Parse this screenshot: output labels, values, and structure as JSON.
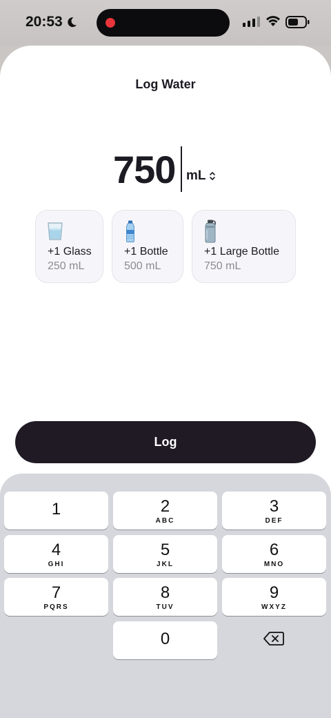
{
  "status_bar": {
    "time": "20:53"
  },
  "sheet": {
    "title": "Log Water"
  },
  "amount": {
    "value": "750",
    "unit": "mL"
  },
  "presets": [
    {
      "icon": "glass-icon",
      "label": "+1 Glass",
      "volume": "250 mL"
    },
    {
      "icon": "bottle-icon",
      "label": "+1 Bottle",
      "volume": "500 mL"
    },
    {
      "icon": "large-bottle-icon",
      "label": "+1 Large Bottle",
      "volume": "750 mL"
    }
  ],
  "log_button": {
    "label": "Log"
  },
  "keypad": {
    "keys": [
      {
        "digit": "1",
        "letters": ""
      },
      {
        "digit": "2",
        "letters": "ABC"
      },
      {
        "digit": "3",
        "letters": "DEF"
      },
      {
        "digit": "4",
        "letters": "GHI"
      },
      {
        "digit": "5",
        "letters": "JKL"
      },
      {
        "digit": "6",
        "letters": "MNO"
      },
      {
        "digit": "7",
        "letters": "PQRS"
      },
      {
        "digit": "8",
        "letters": "TUV"
      },
      {
        "digit": "9",
        "letters": "WXYZ"
      },
      {
        "digit": "0",
        "letters": ""
      }
    ],
    "delete_icon": "delete-backspace-icon"
  },
  "colors": {
    "primary_dark": "#1f1a24",
    "preset_bg": "#f6f6fa",
    "keyboard_bg": "#d5d7dc",
    "recording_dot": "#e8343b"
  }
}
